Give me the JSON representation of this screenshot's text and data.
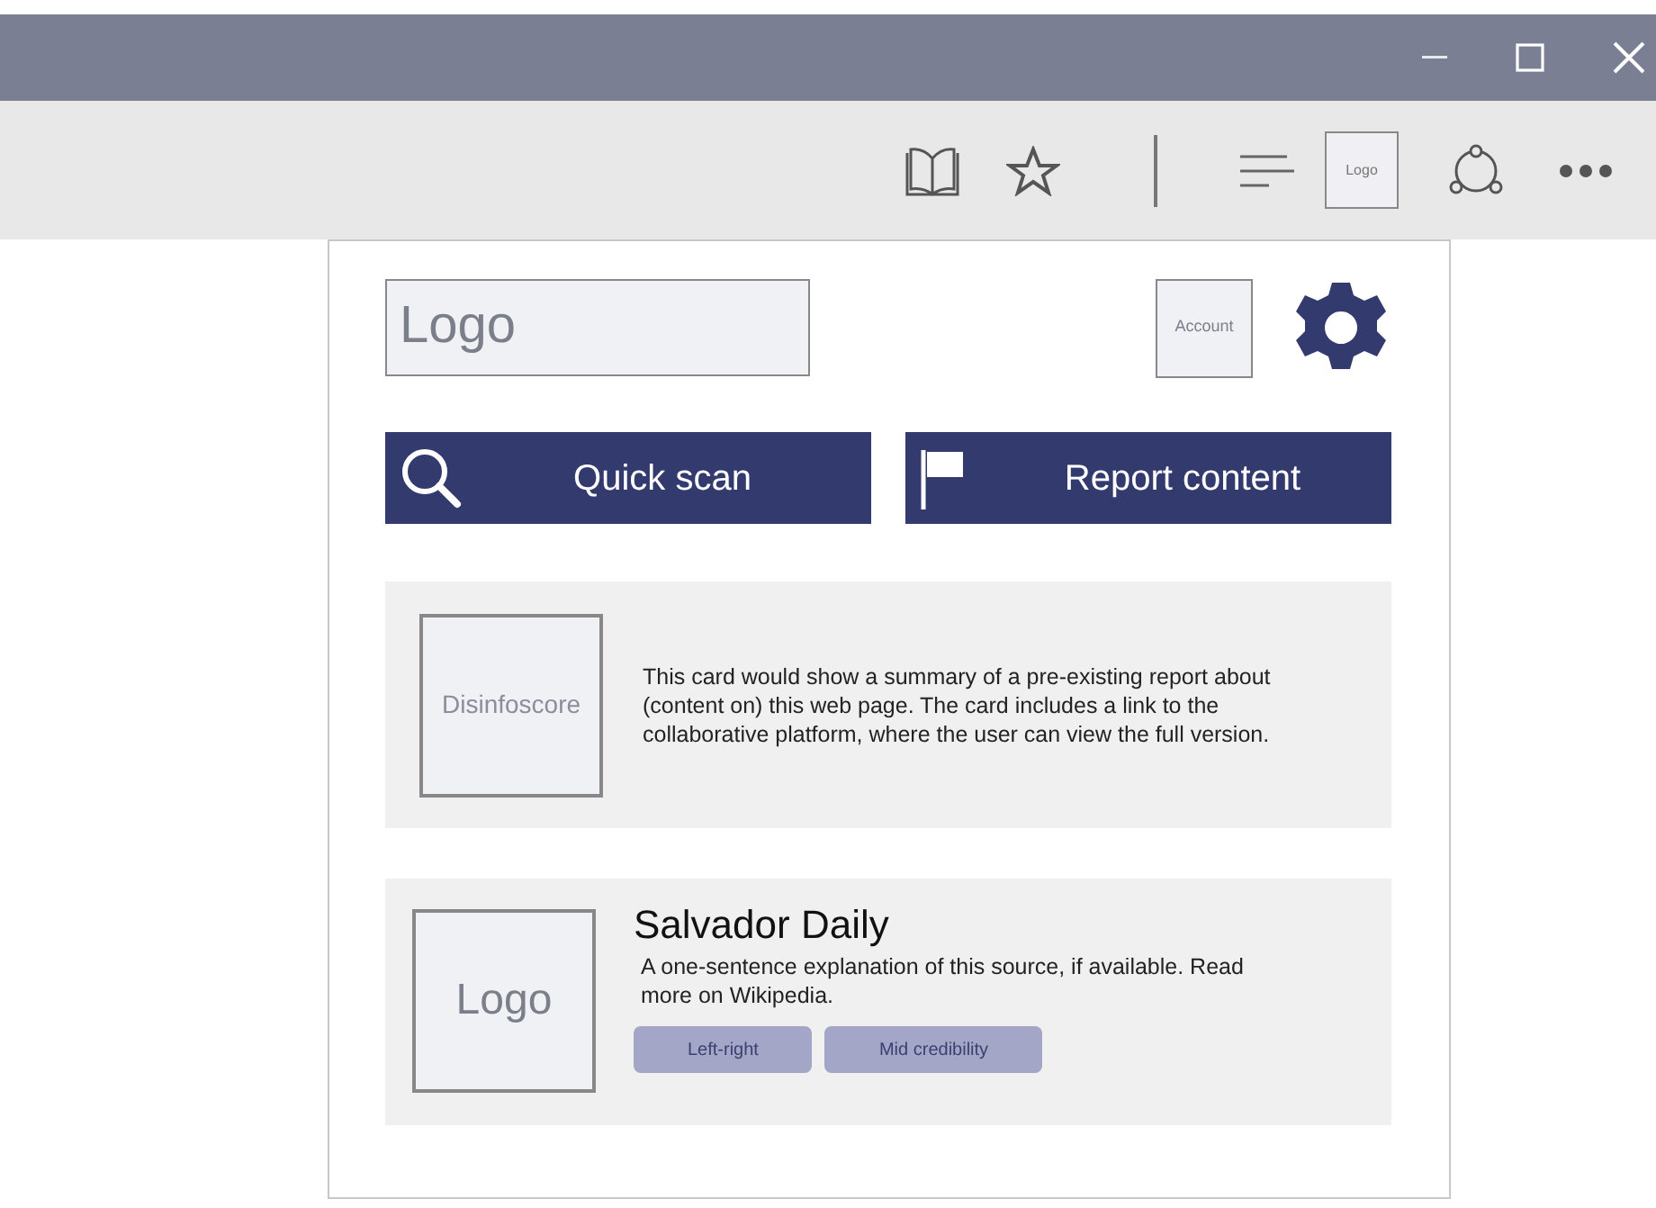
{
  "toolbar": {
    "logo": "Logo"
  },
  "panel": {
    "logo": "Logo",
    "account": "Account",
    "buttons": [
      {
        "label": "Quick scan",
        "kind": "search"
      },
      {
        "label": "Report content",
        "kind": "flag"
      }
    ],
    "report_card": {
      "badge": "Disinfoscore",
      "text": "This card would show a summary of a pre-existing report about (content on) this web page. The card includes a link to the collaborative platform, where the user can view the full version."
    },
    "source_card": {
      "logo": "Logo",
      "name": "Salvador Daily",
      "description": "A one-sentence explanation of this source, if available. Read more on Wikipedia.",
      "tags": [
        "Left-right",
        "Mid credibility"
      ]
    }
  }
}
